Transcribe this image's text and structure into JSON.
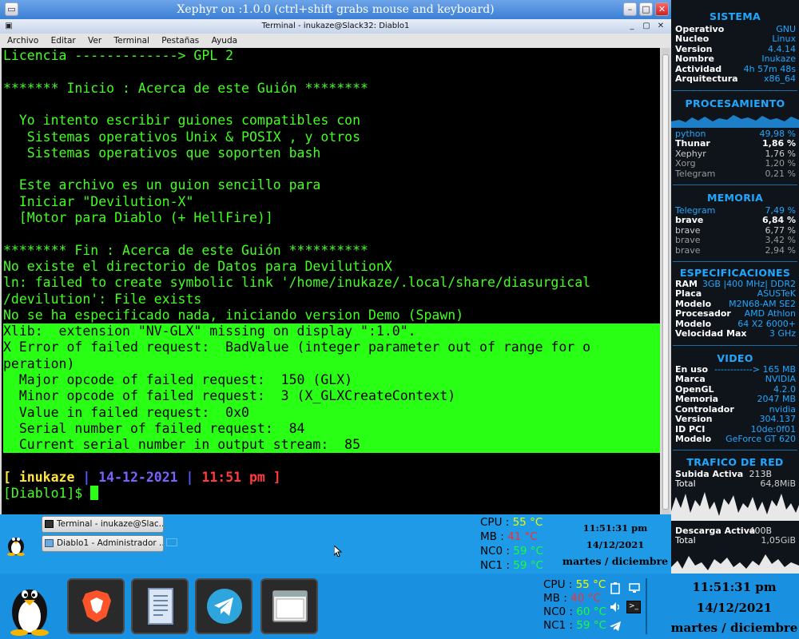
{
  "xephyr": {
    "title": "Xephyr on :1.0.0 (ctrl+shift grabs mouse and keyboard)"
  },
  "terminal": {
    "title": "Terminal - inukaze@Slack32: Diablo1",
    "menu": [
      "Archivo",
      "Editar",
      "Ver",
      "Terminal",
      "Pestañas",
      "Ayuda"
    ],
    "lines": [
      "Licencia -------------> GPL 2",
      "",
      "******* Inicio : Acerca de este Guión ********",
      "",
      "  Yo intento escribir guiones compatibles con",
      "   Sistemas operativos Unix & POSIX , y otros",
      "   Sistemas operativos que soporten bash",
      "",
      "  Este archivo es un guion sencillo para",
      "  Iniciar \"Devilution-X\"",
      "  [Motor para Diablo (+ HellFire)]",
      "",
      "******** Fin : Acerca de este Guión **********",
      "No existe el directorio de Datos para DevilutionX",
      "ln: failed to create symbolic link '/home/inukaze/.local/share/diasurgical",
      "/devilution': File exists",
      "No se ha especificado nada, iniciando version Demo (Spawn)"
    ],
    "error_lines": [
      "Xlib:  extension \"NV-GLX\" missing on display \":1.0\".",
      "X Error of failed request:  BadValue (integer parameter out of range for o",
      "peration)",
      "  Major opcode of failed request:  150 (GLX)",
      "  Minor opcode of failed request:  3 (X_GLXCreateContext)",
      "  Value in failed request:  0x0",
      "  Serial number of failed request:  84",
      "  Current serial number in output stream:  85"
    ],
    "prompt": {
      "open": "[ ",
      "user": "inukaze",
      "sep1": " | ",
      "date": "14-12-2021",
      "sep2": " | ",
      "time": "11:51 pm",
      "close": " ]",
      "cwd": "[Diablo1]$ "
    }
  },
  "inner_taskbar": {
    "tasks": [
      "Terminal - inukaze@Slac...",
      "Diablo1 - Administrador ..."
    ],
    "sensors": [
      {
        "label": "CPU",
        "value": "55 °C",
        "color": "#e6ff00"
      },
      {
        "label": "MB",
        "value": "41 °C",
        "color": "#ff2b2b"
      },
      {
        "label": "NC0",
        "value": "59 °C",
        "color": "#18ff3a"
      },
      {
        "label": "NC1",
        "value": "59 °C",
        "color": "#18ff3a"
      }
    ],
    "clock": {
      "time": "11:51:31 pm",
      "date": "14/12/2021",
      "day": "martes / diciembre"
    }
  },
  "outer_taskbar": {
    "sensors": [
      {
        "label": "CPU",
        "value": "55 °C",
        "color": "#e6ff00"
      },
      {
        "label": "MB",
        "value": "40 °C",
        "color": "#ff2b2b"
      },
      {
        "label": "NC0",
        "value": "60 °C",
        "color": "#18ff3a"
      },
      {
        "label": "NC1",
        "value": "59 °C",
        "color": "#18ff3a"
      }
    ],
    "clock": {
      "time": "11:51:31 pm",
      "date": "14/12/2021",
      "day": "martes / diciembre"
    }
  },
  "conky": {
    "sistema": {
      "title": "SISTEMA",
      "rows": [
        {
          "k": "Operativo",
          "v": "GNU"
        },
        {
          "k": "Nucleo",
          "v": "Linux"
        },
        {
          "k": "Version",
          "v": "4.4.14"
        },
        {
          "k": "Nombre",
          "v": "Inukaze"
        },
        {
          "k": "Actividad",
          "v": "4h 57m 48s"
        },
        {
          "k": "Arquitectura",
          "v": "x86_64"
        }
      ]
    },
    "procesamiento": {
      "title": "PROCESAMIENTO",
      "rows": [
        {
          "k": "python",
          "v": "49,98 %",
          "c": "#1fa8ff"
        },
        {
          "k": "Thunar",
          "v": "1,86 %",
          "c": "#ffffff"
        },
        {
          "k": "Xephyr",
          "v": "1,76 %",
          "c": "#cccccc"
        },
        {
          "k": "Xorg",
          "v": "1,20 %",
          "c": "#999999"
        },
        {
          "k": "Telegram",
          "v": "0,21 %",
          "c": "#999999"
        }
      ]
    },
    "memoria": {
      "title": "MEMORIA",
      "rows": [
        {
          "k": "Telegram",
          "v": "7,49 %",
          "c": "#1fa8ff"
        },
        {
          "k": "brave",
          "v": "6,84 %",
          "c": "#ffffff"
        },
        {
          "k": "brave",
          "v": "6,77 %",
          "c": "#cccccc"
        },
        {
          "k": "brave",
          "v": "3,42 %",
          "c": "#999999"
        },
        {
          "k": "brave",
          "v": "2,94 %",
          "c": "#999999"
        }
      ]
    },
    "especificaciones": {
      "title": "ESPECIFICACIONES",
      "rows": [
        {
          "k": "RAM",
          "v": "3GB |400 MHz| DDR2"
        },
        {
          "k": "Placa",
          "v": "ASUSTeK"
        },
        {
          "k": "Modelo",
          "v": "M2N68-AM SE2"
        },
        {
          "k": "Procesador",
          "v": "AMD Athlon"
        },
        {
          "k": "Modelo",
          "v": "64 X2 6000+"
        },
        {
          "k": "Velocidad Max",
          "v": "3 GHz"
        }
      ]
    },
    "video": {
      "title": "VIDEO",
      "rows": [
        {
          "k": "En uso",
          "v": "------------> 165 MB"
        },
        {
          "k": "Marca",
          "v": "NVIDIA"
        },
        {
          "k": "OpenGL",
          "v": "4.2.0"
        },
        {
          "k": "Memoria",
          "v": "2047 MB"
        },
        {
          "k": "Controlador",
          "v": "nvidia"
        },
        {
          "k": "Version",
          "v": "304.137"
        },
        {
          "k": "ID PCI",
          "v": "10de:0f01"
        },
        {
          "k": "Modelo",
          "v": "GeForce GT 620"
        }
      ]
    },
    "red": {
      "title": "TRAFICO DE RED",
      "up_label": "Subida Activa",
      "up_value": "213B",
      "up_total_label": "Total",
      "up_total_value": "64,8MiB",
      "down_label": "Descarga Activa",
      "down_value": "400B",
      "down_total_label": "Total",
      "down_total_value": "1,05GiB"
    }
  }
}
